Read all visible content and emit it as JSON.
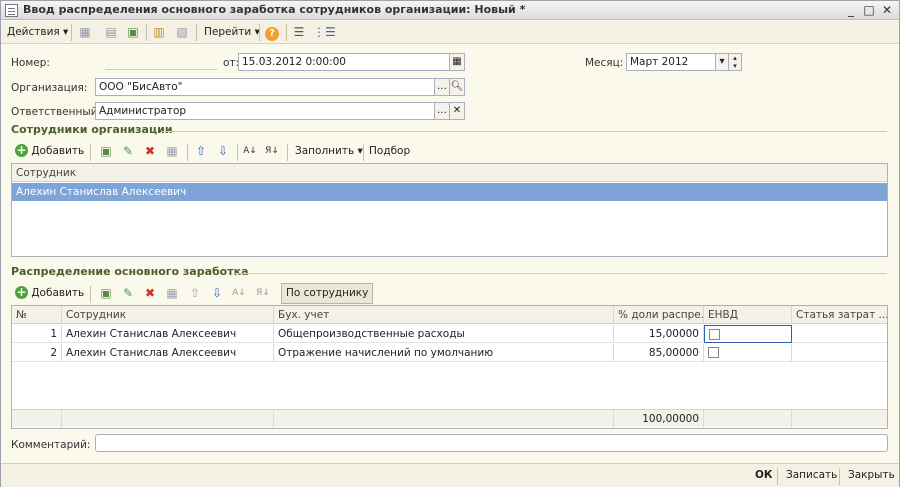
{
  "window": {
    "title": "Ввод распределения основного заработка сотрудников организации: Новый *"
  },
  "toolbar": {
    "actions_label": "Действия",
    "goto_label": "Перейти"
  },
  "header": {
    "number_label": "Номер:",
    "number_value": "",
    "date_label": "от:",
    "date_value": "15.03.2012 0:00:00",
    "month_label": "Месяц:",
    "month_value": "Март 2012",
    "org_label": "Организация:",
    "org_value": "ООО \"БисАвто\"",
    "resp_label": "Ответственный:",
    "resp_value": "Администратор"
  },
  "employees_section": {
    "title": "Сотрудники организации",
    "add_label": "Добавить",
    "fill_label": "Заполнить",
    "select_label": "Подбор",
    "column": "Сотрудник",
    "rows": [
      "Алехин Станислав Алексеевич"
    ]
  },
  "distribution_section": {
    "title": "Распределение основного заработка",
    "add_label": "Добавить",
    "by_employee_label": "По сотруднику",
    "columns": [
      "№",
      "Сотрудник",
      "Бух. учет",
      "% доли распре...",
      "ЕНВД",
      "Статья затрат ..."
    ],
    "rows": [
      {
        "n": "1",
        "employee": "Алехин Станислав Алексеевич",
        "account": "Общепроизводственные расходы",
        "share": "15,00000",
        "envd": false
      },
      {
        "n": "2",
        "employee": "Алехин Станислав Алексеевич",
        "account": "Отражение начислений по умолчанию",
        "share": "85,00000",
        "envd": false
      }
    ],
    "total_share": "100,00000"
  },
  "comment": {
    "label": "Комментарий:",
    "value": ""
  },
  "bottom": {
    "ok_label": "ОК",
    "save_label": "Записать",
    "close_label": "Закрыть"
  },
  "colors": {
    "selection": "#7ea4d8",
    "section_title": "#4d5e2a",
    "background": "#fbf8ec"
  }
}
